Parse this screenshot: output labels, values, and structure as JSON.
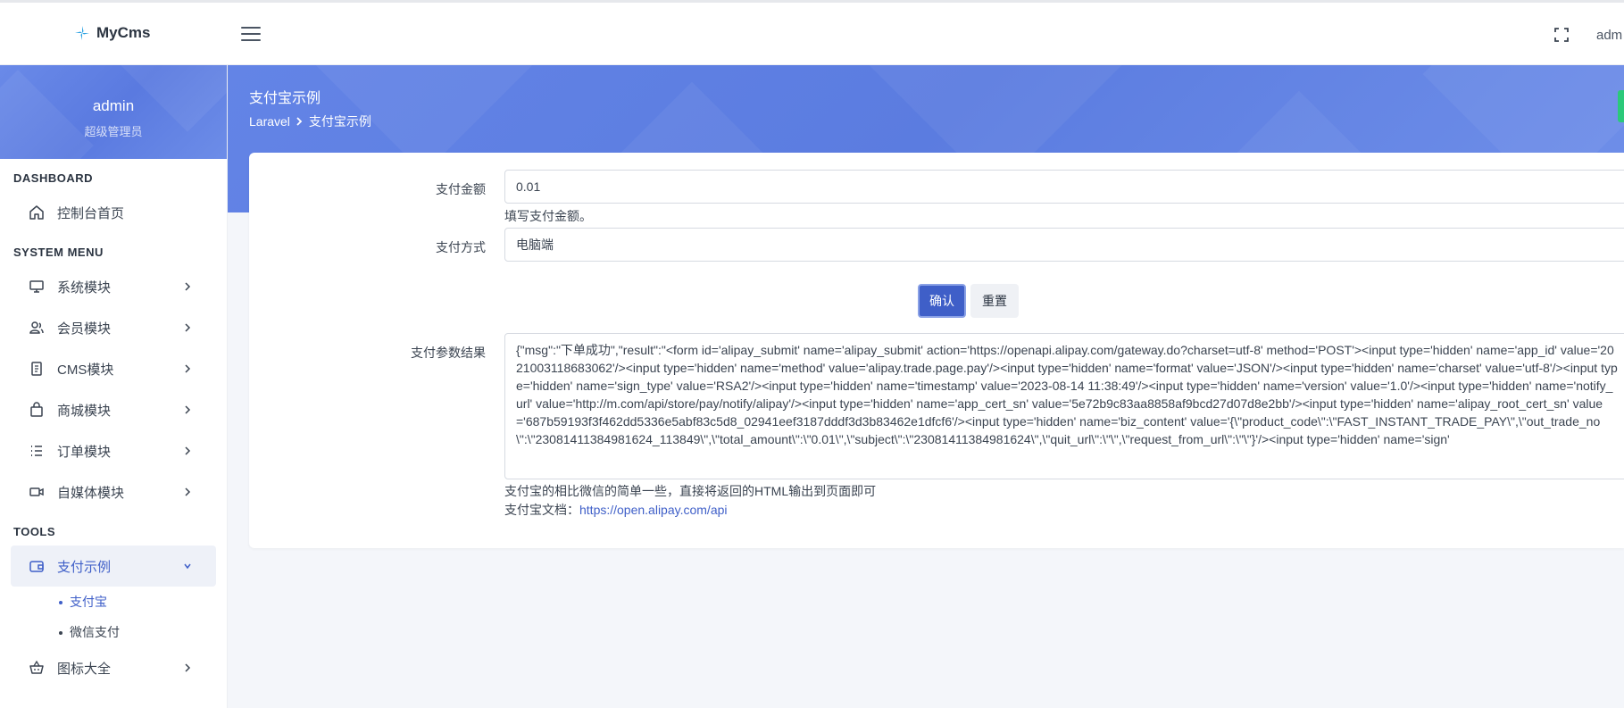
{
  "app": {
    "brand": "MyCms",
    "top_user": "adm"
  },
  "sidebar": {
    "user_name": "admin",
    "user_role": "超级管理员",
    "sections": {
      "dashboard": "DASHBOARD",
      "system": "SYSTEM MENU",
      "tools": "TOOLS"
    },
    "items": {
      "dashboard_home": "控制台首页",
      "system_module": "系统模块",
      "member_module": "会员模块",
      "cms_module": "CMS模块",
      "shop_module": "商城模块",
      "order_module": "订单模块",
      "media_module": "自媒体模块",
      "payment_demo": "支付示例",
      "icons": "图标大全"
    },
    "sub_items": {
      "alipay": "支付宝",
      "wechat_pay": "微信支付"
    },
    "icons": {
      "dashboard_home": "home-icon",
      "system_module": "monitor-icon",
      "member_module": "users-icon",
      "cms_module": "document-icon",
      "shop_module": "bag-icon",
      "order_module": "list-icon",
      "media_module": "video-icon",
      "payment_demo": "wallet-icon",
      "icons": "basket-icon"
    }
  },
  "header": {
    "title": "支付宝示例",
    "breadcrumb_root": "Laravel",
    "breadcrumb_current": "支付宝示例"
  },
  "form": {
    "amount_label": "支付金额",
    "amount_value": "0.01",
    "amount_help": "填写支付金额。",
    "method_label": "支付方式",
    "method_value": "电脑端",
    "confirm_label": "确认",
    "reset_label": "重置",
    "result_label": "支付参数结果",
    "result_text": "{\"msg\":\"下单成功\",\"result\":\"<form id='alipay_submit' name='alipay_submit' action='https://openapi.alipay.com/gateway.do?charset=utf-8' method='POST'><input type='hidden' name='app_id' value='2021003118683062'/><input type='hidden' name='method' value='alipay.trade.page.pay'/><input type='hidden' name='format' value='JSON'/><input type='hidden' name='charset' value='utf-8'/><input type='hidden' name='sign_type' value='RSA2'/><input type='hidden' name='timestamp' value='2023-08-14 11:38:49'/><input type='hidden' name='version' value='1.0'/><input type='hidden' name='notify_url' value='http://m.com/api/store/pay/notify/alipay'/><input type='hidden' name='app_cert_sn' value='5e72b9c83aa8858af9bcd27d07d8e2bb'/><input type='hidden' name='alipay_root_cert_sn' value='687b59193f3f462dd5336e5abf83c5d8_02941eef3187dddf3d3b83462e1dfcf6'/><input type='hidden' name='biz_content' value='{\\\"product_code\\\":\\\"FAST_INSTANT_TRADE_PAY\\\",\\\"out_trade_no\\\":\\\"23081411384981624_113849\\\",\\\"total_amount\\\":\\\"0.01\\\",\\\"subject\\\":\\\"23081411384981624\\\",\\\"quit_url\\\":\\\"\\\",\\\"request_from_url\\\":\\\"\\\"}'/><input type='hidden' name='sign'",
    "result_help": "支付宝的相比微信的简单一些，直接将返回的HTML输出到页面即可",
    "doc_prefix": "支付宝文档：",
    "doc_link": "https://open.alipay.com/api"
  }
}
